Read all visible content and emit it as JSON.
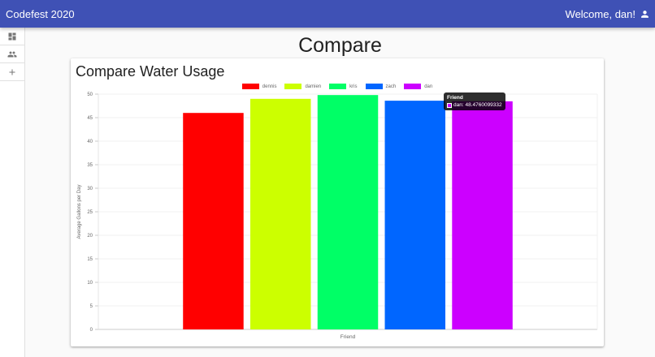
{
  "app": {
    "title": "Codefest 2020",
    "welcome": "Welcome, dan!",
    "user_icon": "person-icon"
  },
  "sidebar": {
    "items": [
      {
        "icon": "dashboard-icon"
      },
      {
        "icon": "people-icon"
      },
      {
        "icon": "add-icon"
      }
    ]
  },
  "page": {
    "title": "Compare"
  },
  "card": {
    "title": "Compare Water Usage"
  },
  "tooltip": {
    "title": "Friend",
    "label": "dan: 48.4760099332",
    "color": "#cc00ff"
  },
  "chart_data": {
    "type": "bar",
    "categories": [
      "Friend"
    ],
    "series": [
      {
        "name": "dennis",
        "values": [
          46
        ],
        "color": "#ff0000"
      },
      {
        "name": "damien",
        "values": [
          49
        ],
        "color": "#ccff00"
      },
      {
        "name": "kris",
        "values": [
          49.8
        ],
        "color": "#00ff66"
      },
      {
        "name": "zach",
        "values": [
          48.6
        ],
        "color": "#0066ff"
      },
      {
        "name": "dan",
        "values": [
          48.4760099332
        ],
        "color": "#cc00ff"
      }
    ],
    "xlabel": "Friend",
    "ylabel": "Average Gallons per Day",
    "ylim": [
      0,
      50
    ],
    "yticks": [
      "0",
      "5",
      "10",
      "15",
      "20",
      "25",
      "30",
      "35",
      "40",
      "45",
      "50"
    ],
    "grid": true,
    "legend": "top-center"
  }
}
